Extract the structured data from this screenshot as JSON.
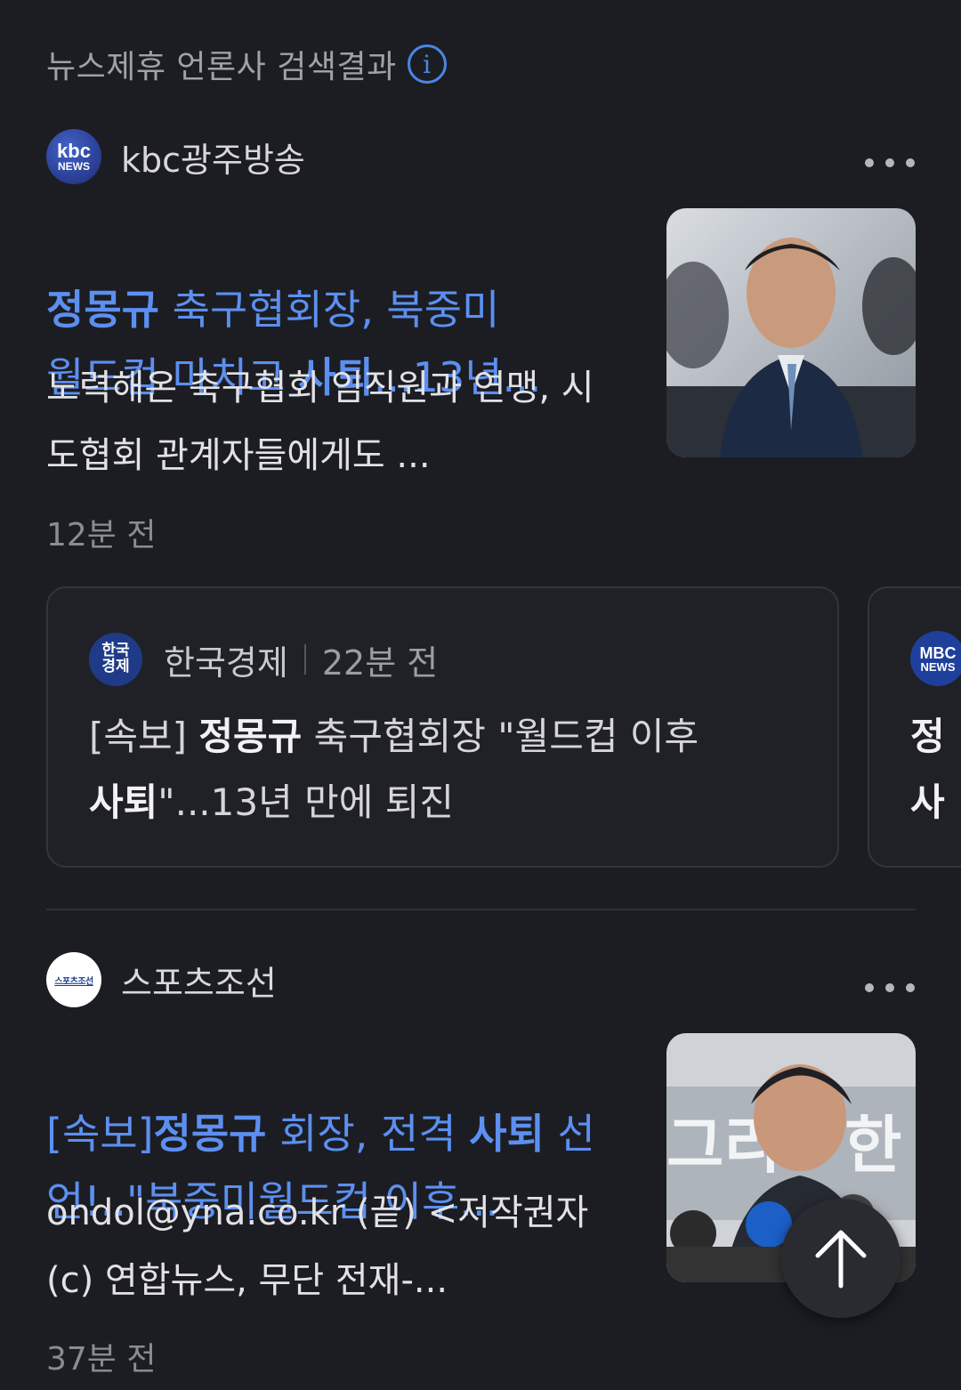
{
  "section": {
    "title": "뉴스제휴 언론사 검색결과",
    "info_icon": "i"
  },
  "articles": [
    {
      "press": {
        "name": "kbc광주방송",
        "logo_line1": "kbc",
        "logo_line2": "NEWS",
        "logo_color": "#2c3e8f"
      },
      "headline_parts": [
        "정몽규",
        " 축구협회장, 북중미 ",
        "월드컵 마치고 ",
        "사퇴",
        "...13년..."
      ],
      "snippet": "노력해온 축구협회 임직원과 연맹, 시도협회 관계자들에게도 ...",
      "time": "12분 전"
    },
    {
      "press": {
        "name": "스포츠조선",
        "logo_text": "스포츠조선",
        "logo_color": "#ffffff"
      },
      "headline_parts": [
        "[속보]",
        "정몽규",
        " 회장, 전격 ",
        "사퇴",
        " 선언!..\"북중미월드컵 이후..."
      ],
      "snippet": "ondol@yna.co.kr (끝) <저작권자(c) 연합뉴스, 무단 전재-...",
      "time": "37분 전"
    }
  ],
  "related": [
    {
      "press_name": "한국경제",
      "logo_line1": "한국",
      "logo_line2": "경제",
      "time": "22분 전",
      "title_parts": [
        "[속보] ",
        "정몽규",
        " 축구협회장 \"월드컵 이후 ",
        "사퇴",
        "\"...13년 만에 퇴진"
      ]
    },
    {
      "press_name": "MBC NEWS",
      "logo_line1": "MBC",
      "logo_line2": "NEWS",
      "title_line1": "정",
      "title_line2": "사"
    }
  ],
  "scroll_top_icon": "arrow-up-icon",
  "colors": {
    "background": "#1c1d22",
    "link_blue": "#5c8ff0",
    "muted": "#8b8c93"
  }
}
